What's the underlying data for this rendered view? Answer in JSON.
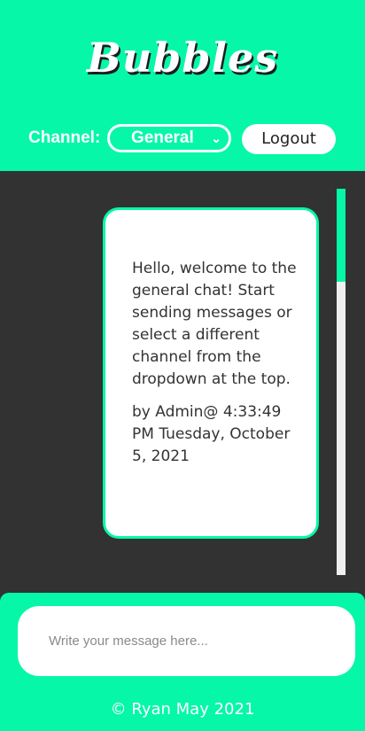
{
  "app": {
    "logo": "Bubbles",
    "brand_color": "#06f7a8",
    "background_color": "#323232"
  },
  "header": {
    "channel_label": "Channel:",
    "channel_selected": "General",
    "channel_chevron": "⌄",
    "logout_label": "Logout"
  },
  "chat": {
    "messages": [
      {
        "text": "Hello, welcome to the general chat! Start sending messages or select a different channel from the dropdown at the top.",
        "meta": "by Admin@ 4:33:49 PM Tuesday, October 5, 2021"
      }
    ],
    "scroll_position_fraction": 0.0,
    "scroll_visible_fraction": 0.24
  },
  "composer": {
    "placeholder": "Write your message here..."
  },
  "footer": {
    "copyright": "© Ryan May 2021"
  }
}
